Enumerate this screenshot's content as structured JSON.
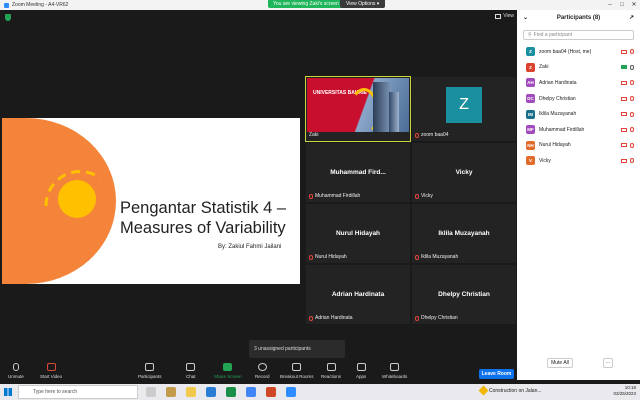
{
  "window": {
    "title": "Zoom Meeting - A4-VR62"
  },
  "share_banner": {
    "viewing_text": "You are viewing Zaki's screen",
    "view_options_label": "View Options"
  },
  "view_button": {
    "label": "View"
  },
  "slide": {
    "title": "Pengantar Statistik 4 – Measures of Variability",
    "author": "By: Zakiul Fahmi Jailani"
  },
  "tiles": [
    {
      "name": "",
      "label": "Zaki",
      "banner_text": "UNIVERSITAS BAKRIE"
    },
    {
      "name": "",
      "label": "zoom baa04",
      "avatar_letter": "Z"
    },
    {
      "name": "Muhammad  Fird...",
      "label": "Muhammad Firdillah"
    },
    {
      "name": "Vicky",
      "label": "Vicky"
    },
    {
      "name": "Nurul Hidayah",
      "label": "Nurul Hidayah"
    },
    {
      "name": "Iklila Muzayanah",
      "label": "Iklila Muzayanah"
    },
    {
      "name": "Adrian Hardinata",
      "label": "Adrian Hardinata"
    },
    {
      "name": "Dhelpy Christian",
      "label": "Dhelpy Christian"
    }
  ],
  "unassigned": {
    "text": "3 unassigned participants"
  },
  "participants_panel": {
    "title": "Participants (8)",
    "search_placeholder": "Find a participant",
    "participants": [
      {
        "initials": "Z",
        "name": "zoom baa04 (Host, me)",
        "color": "#1a8fa0",
        "mic": "off",
        "cam": "off"
      },
      {
        "initials": "Z",
        "name": "Zaki",
        "color": "#d9442f",
        "mic": "on",
        "cam": "on"
      },
      {
        "initials": "AH",
        "name": "Adrian Hardinata",
        "color": "#a14bbd",
        "mic": "off",
        "cam": "off"
      },
      {
        "initials": "DC",
        "name": "Dhelpy Christian",
        "color": "#a14bbd",
        "mic": "off",
        "cam": "off"
      },
      {
        "initials": "IM",
        "name": "Iklila Muzayanah",
        "color": "#1a6f8a",
        "mic": "off",
        "cam": "off"
      },
      {
        "initials": "MF",
        "name": "Muhammad Firdillah",
        "color": "#a14bbd",
        "mic": "off",
        "cam": "off"
      },
      {
        "initials": "NH",
        "name": "Nurul Hidayah",
        "color": "#e06b2a",
        "mic": "off",
        "cam": "off"
      },
      {
        "initials": "V",
        "name": "Vicky",
        "color": "#e06b2a",
        "mic": "off",
        "cam": "off"
      }
    ],
    "mute_all_label": "Mute All",
    "more_label": "..."
  },
  "toolbar": {
    "unmute": "Unmute",
    "start_video": "Start Video",
    "participants": "Participants",
    "participants_count": "8",
    "chat": "Chat",
    "share_screen": "Share Screen",
    "record": "Record",
    "breakout_rooms": "Breakout Rooms",
    "reactions": "Reactions",
    "apps": "Apps",
    "whiteboards": "Whiteboards",
    "leave": "Leave Room"
  },
  "taskbar": {
    "search_placeholder": "Type here to search",
    "weather_text": "Construction on Jalan...",
    "time": "10:18",
    "date": "03/25/2023"
  }
}
